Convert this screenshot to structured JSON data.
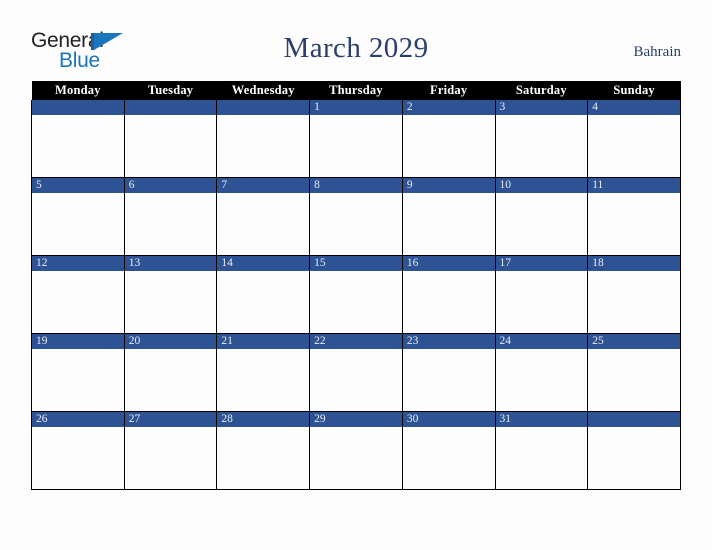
{
  "brand": {
    "name_part1": "General",
    "name_part2": "Blue",
    "flag_icon": "blue-triangle-flag-icon",
    "accent_color": "#1b75bb",
    "dark_color": "#231f20"
  },
  "header": {
    "title": "March 2029",
    "country": "Bahrain",
    "title_color": "#2a3f6b"
  },
  "calendar": {
    "month": "March",
    "year": "2029",
    "header_bg": "#000000",
    "header_text_color": "#ffffff",
    "daybar_bg": "#2e5394",
    "daybar_text_color": "#e8ecf5",
    "cell_bg": "#fdfdfe",
    "border_color": "#000000",
    "weekday_headers": [
      "Monday",
      "Tuesday",
      "Wednesday",
      "Thursday",
      "Friday",
      "Saturday",
      "Sunday"
    ],
    "weeks": [
      [
        "",
        "",
        "",
        "1",
        "2",
        "3",
        "4"
      ],
      [
        "5",
        "6",
        "7",
        "8",
        "9",
        "10",
        "11"
      ],
      [
        "12",
        "13",
        "14",
        "15",
        "16",
        "17",
        "18"
      ],
      [
        "19",
        "20",
        "21",
        "22",
        "23",
        "24",
        "25"
      ],
      [
        "26",
        "27",
        "28",
        "29",
        "30",
        "31",
        ""
      ]
    ]
  }
}
